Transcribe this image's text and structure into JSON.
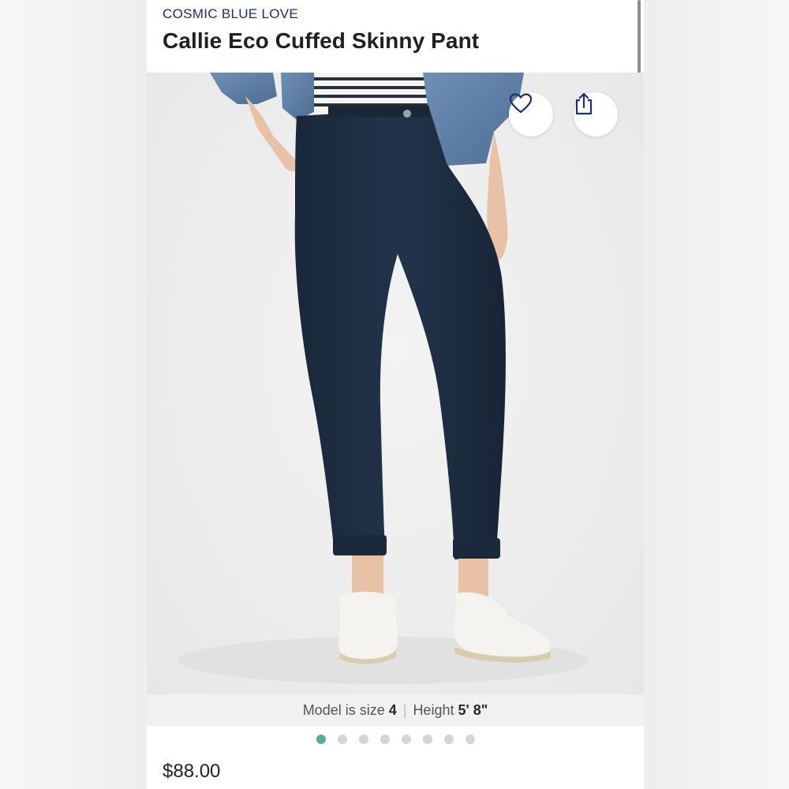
{
  "product": {
    "brand": "COSMIC BLUE LOVE",
    "title": "Callie Eco Cuffed Skinny Pant",
    "price": "$88.00"
  },
  "model_info": {
    "size_label": "Model is size",
    "size_value": "4",
    "height_label": "Height",
    "height_value": "5' 8\""
  },
  "actions": {
    "favorite_icon": "heart-icon",
    "share_icon": "share-icon"
  },
  "carousel": {
    "total_images": 8,
    "active_index": 0
  },
  "colors": {
    "brand_text": "#1e2f6b",
    "active_dot": "#5fa99b",
    "inactive_dot": "#d4d4d4",
    "pant": "#1d2b3f"
  }
}
